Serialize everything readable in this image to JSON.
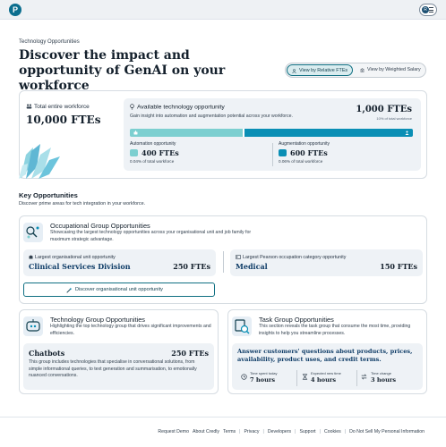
{
  "header": {
    "logo": "P",
    "avatar": "R"
  },
  "page": {
    "eyebrow": "Technology Opportunities",
    "title": "Discover the impact and opportunity of GenAI on your workforce"
  },
  "view_toggle": {
    "relative": "View by Relative FTEs",
    "salary": "View by Weighted Salary",
    "selected": "relative"
  },
  "summary": {
    "total_label": "Total entire workforce",
    "total_value": "10,000 FTEs",
    "available_title": "Available technology opportunity",
    "available_sub": "Gain insight into automation and augmentation potential across your workforce.",
    "available_value": "1,000 FTEs",
    "available_pct": "10% of total workforce",
    "split": {
      "automation_fraction": 0.4,
      "augmentation_fraction": 0.6
    },
    "automation": {
      "label": "Automation opportunity",
      "value": "400 FTEs",
      "pct": "0.04% of total workforce"
    },
    "augmentation": {
      "label": "Augmentation opportunity",
      "value": "600 FTEs",
      "pct": "0.06% of total workforce"
    }
  },
  "key": {
    "title": "Key Opportunities",
    "subtitle": "Discover prime areas for tech integration in your workforce."
  },
  "occupational": {
    "title": "Occupational Group Opportunities",
    "subtitle": "Showcasing the largest technology opportunities across your organisational unit and job family for maximum strategic advantage.",
    "unit_label": "Largest organisational unit opportunity",
    "unit_name": "Clinical Services Division",
    "unit_value": "250 FTEs",
    "pearson_label": "Largest Pearson occupation category opportunity",
    "pearson_name": "Medical",
    "pearson_value": "150 FTEs",
    "button": "Discover organisational unit opportunity"
  },
  "technology": {
    "title": "Technology Group Opportunities",
    "subtitle": "Highlighting the top technology group that drives significant improvements and efficiencies.",
    "name": "Chatbots",
    "value": "250 FTEs",
    "desc": "This group includes technologies that specialise in conversational solutions, from simple informational queries, to text generation and summarisation, to emotionally nuanced conversations."
  },
  "task": {
    "title": "Task Group Opportunities",
    "subtitle": "This section reveals the task group that consume the most time, providing insights to help you streamline processes.",
    "question": "Answer customers' questions about products, prices, availability, product uses, and credit terms.",
    "time_spent_label": "Time spent today",
    "time_spent": "7 hours",
    "expected_label": "Expected new time",
    "expected": "4 hours",
    "change_label": "Time change",
    "change": "3 hours"
  },
  "footer": {
    "links": [
      "Request Demo",
      "About Credly",
      "Terms",
      "Privacy",
      "Developers",
      "Support",
      "Cookies",
      "Do Not Sell My Personal Information"
    ]
  },
  "colors": {
    "automation": "#7ccfd0",
    "augmentation": "#0a8fb5",
    "brand": "#0b6e8e",
    "accent_text": "#0d3b66"
  }
}
